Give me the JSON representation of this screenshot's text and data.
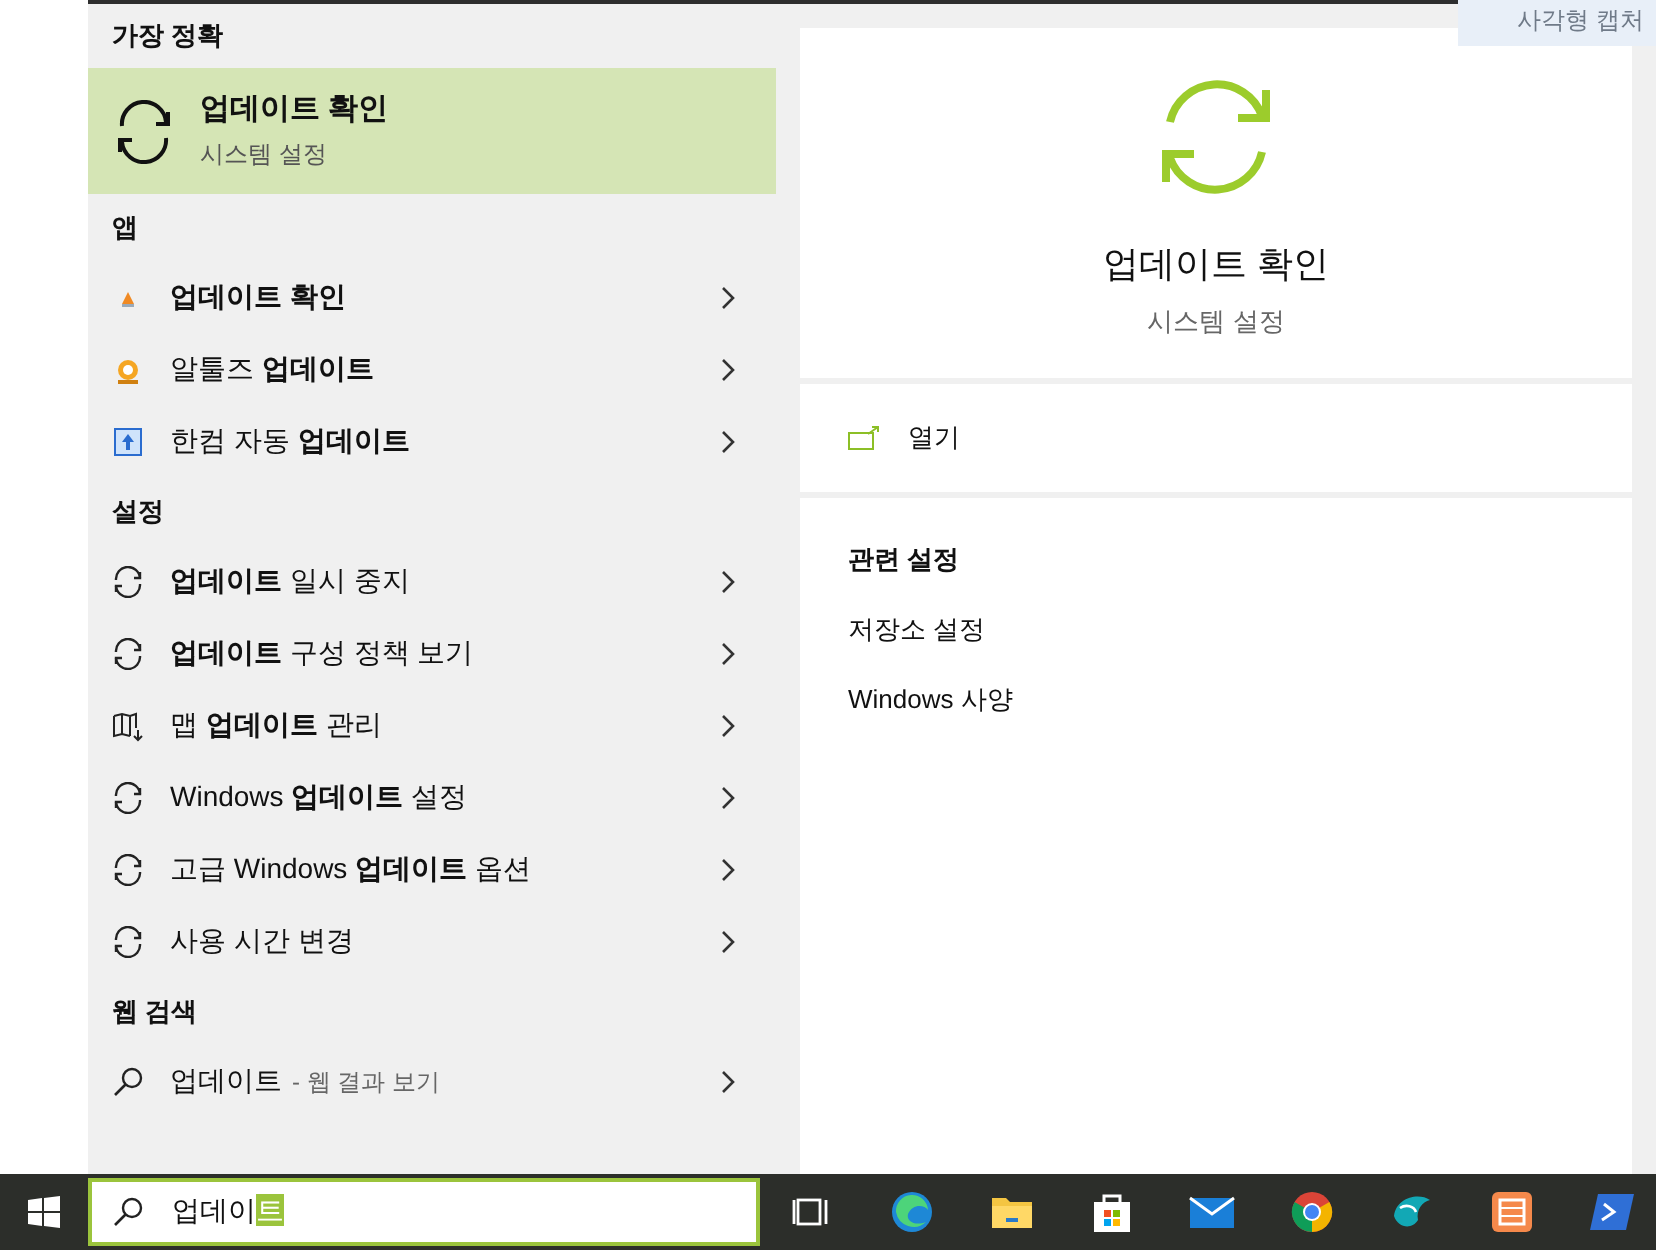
{
  "background_hint": "사각형 캡처",
  "best_match": {
    "header": "가장 정확",
    "title": "업데이트 확인",
    "subtitle": "시스템 설정",
    "selected": true
  },
  "sections": [
    {
      "header": "앱",
      "items": [
        {
          "kind": "app-orange",
          "label": "**업데이트 확인**"
        },
        {
          "kind": "app-mascot",
          "label": "알툴즈 **업데이트**"
        },
        {
          "kind": "app-blue",
          "label": "한컴 자동 **업데이트**"
        }
      ]
    },
    {
      "header": "설정",
      "items": [
        {
          "kind": "sync",
          "label": "**업데이트** 일시 중지"
        },
        {
          "kind": "sync",
          "label": "**업데이트** 구성 정책 보기"
        },
        {
          "kind": "map",
          "label": "맵 **업데이트** 관리"
        },
        {
          "kind": "sync",
          "label": "Windows **업데이트** 설정"
        },
        {
          "kind": "sync",
          "label": "고급 Windows **업데이트** 옵션"
        },
        {
          "kind": "sync",
          "label": "사용 시간 변경"
        }
      ]
    },
    {
      "header": "웹 검색",
      "items": [
        {
          "kind": "search",
          "label": "업데이트",
          "suffix": "- 웹 결과 보기"
        }
      ]
    }
  ],
  "detail": {
    "title": "업데이트 확인",
    "subtitle": "시스템 설정",
    "open_label": "열기",
    "related_header": "관련 설정",
    "related": [
      "저장소 설정",
      "Windows 사양"
    ]
  },
  "search": {
    "value": "업데이",
    "composing": "트"
  },
  "taskbar": [
    {
      "kind": "task-view"
    },
    {
      "kind": "edge"
    },
    {
      "kind": "folder"
    },
    {
      "kind": "store"
    },
    {
      "kind": "mail"
    },
    {
      "kind": "chrome"
    },
    {
      "kind": "whale"
    },
    {
      "kind": "app"
    },
    {
      "kind": "terminal"
    }
  ]
}
